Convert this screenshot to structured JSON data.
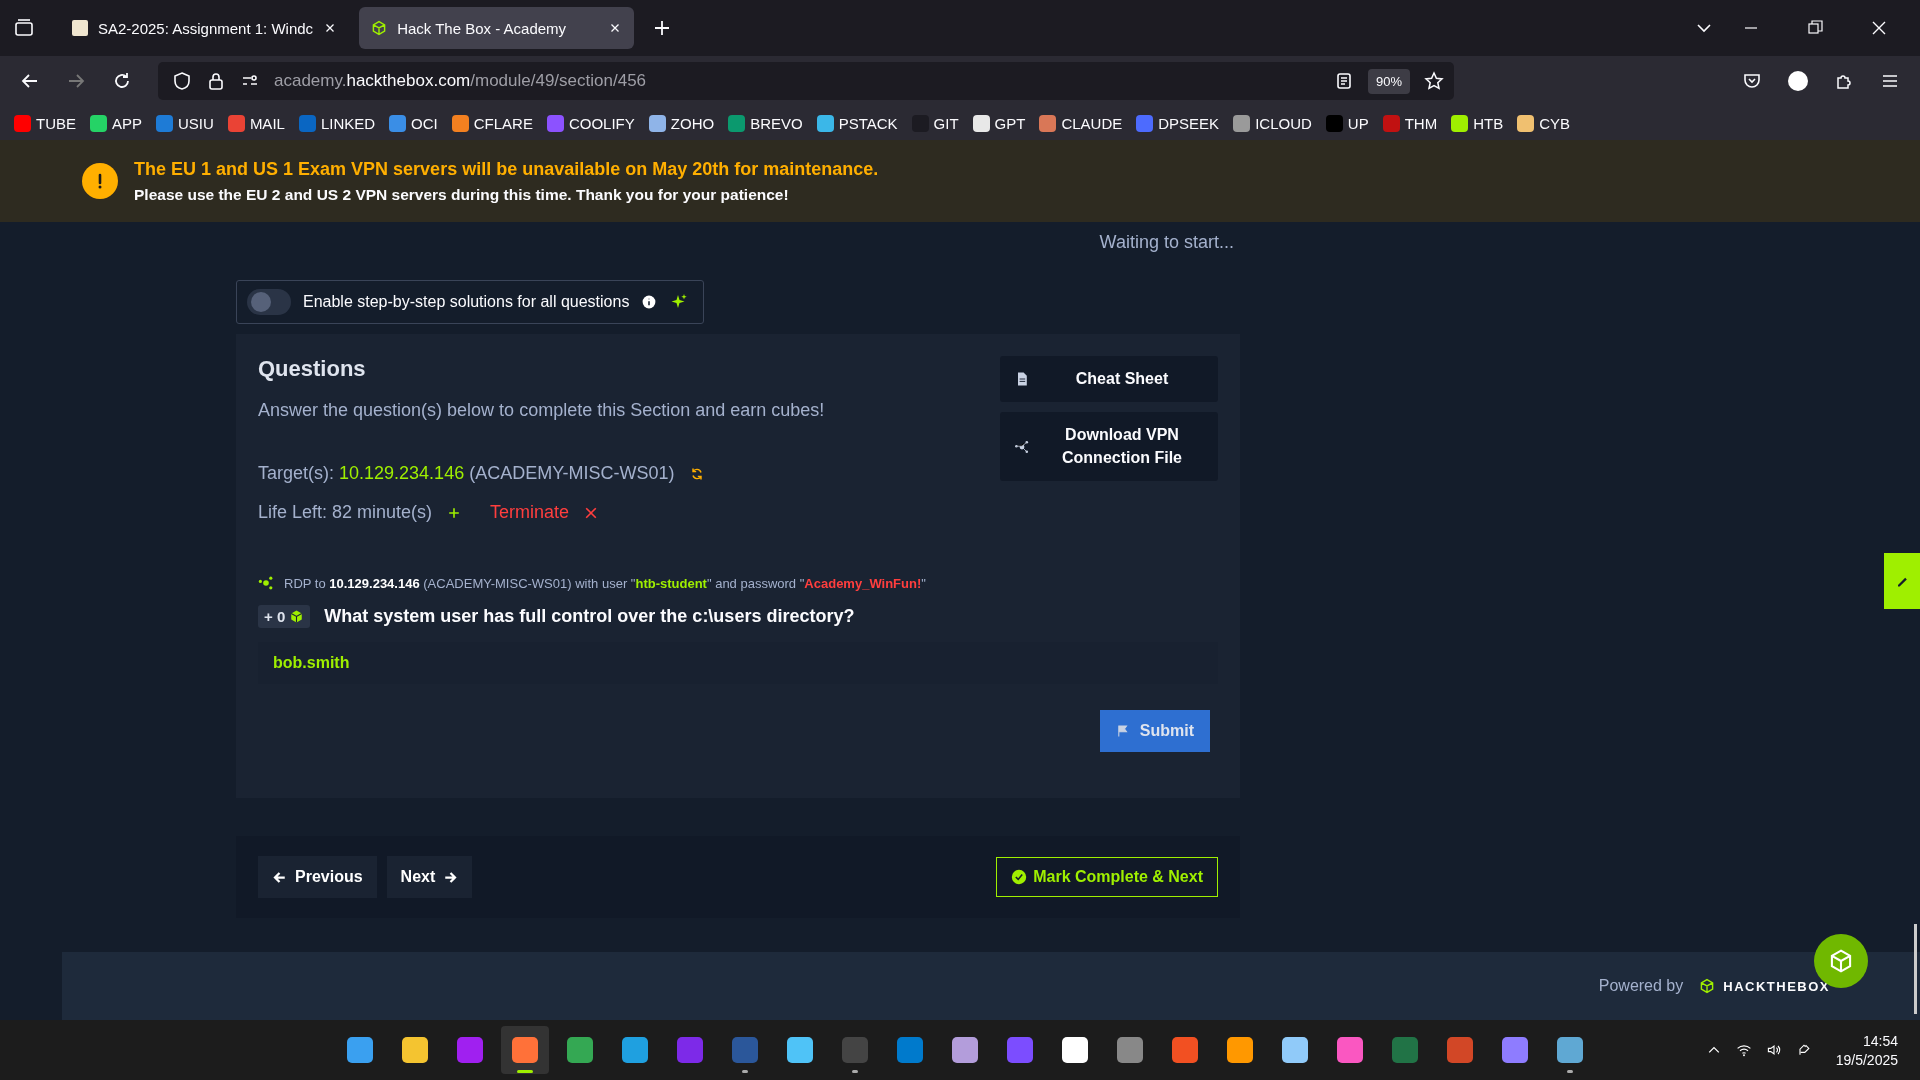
{
  "browser": {
    "tabs": [
      {
        "title": "SA2-2025: Assignment 1: Windc",
        "selected": false
      },
      {
        "title": "Hack The Box - Academy",
        "selected": true
      }
    ],
    "url": {
      "pre": "academy.",
      "domain": "hackthebox.com",
      "path": "/module/49/section/456"
    },
    "zoom": "90%",
    "bookmarks": [
      {
        "label": "TUBE",
        "color": "#ff0000"
      },
      {
        "label": "APP",
        "color": "#25d366"
      },
      {
        "label": "USIU",
        "color": "#1e7bd6"
      },
      {
        "label": "MAIL",
        "color": "#ea4335"
      },
      {
        "label": "LINKED",
        "color": "#0a66c2"
      },
      {
        "label": "OCI",
        "color": "#3a8ee6"
      },
      {
        "label": "CFLARE",
        "color": "#f38020"
      },
      {
        "label": "COOLIFY",
        "color": "#8c52ff"
      },
      {
        "label": "ZOHO",
        "color": "#8fb4e8"
      },
      {
        "label": "BREVO",
        "color": "#0b996e"
      },
      {
        "label": "PSTACK",
        "color": "#3bb7e8"
      },
      {
        "label": "GIT",
        "color": "#1c1b22"
      },
      {
        "label": "GPT",
        "color": "#e8e8e8"
      },
      {
        "label": "CLAUDE",
        "color": "#d97757"
      },
      {
        "label": "DPSEEK",
        "color": "#4d6bfe"
      },
      {
        "label": "ICLOUD",
        "color": "#9a9a9a"
      },
      {
        "label": "UP",
        "color": "#000000"
      },
      {
        "label": "THM",
        "color": "#c11111"
      },
      {
        "label": "HTB",
        "color": "#9fef00"
      },
      {
        "label": "CYB",
        "color": "#f0c070"
      }
    ]
  },
  "banner": {
    "title": "The EU 1 and US 1 Exam VPN servers will be unavailable on May 20th for maintenance.",
    "message": "Please use the EU 2 and US 2 VPN servers during this time. Thank you for your patience!"
  },
  "status": "Waiting to start...",
  "solutions_toggle": {
    "label": "Enable step-by-step solutions for all questions",
    "on": false
  },
  "questions": {
    "title": "Questions",
    "subtitle": "Answer the question(s) below to complete this Section and earn cubes!",
    "target": {
      "label": "Target(s):",
      "ip": "10.129.234.146",
      "host": "(ACADEMY-MISC-WS01)"
    },
    "life": "Life Left: 82 minute(s)",
    "terminate": "Terminate",
    "side_buttons": [
      {
        "label": "Cheat Sheet",
        "kind": "sheet"
      },
      {
        "label": "Download VPN Connection File",
        "kind": "vpn"
      }
    ],
    "rdp": [
      {
        "text": "RDP to ",
        "kind": "plain"
      },
      {
        "text": "10.129.234.146",
        "kind": "bold"
      },
      {
        "text": " (ACADEMY-MISC-WS01) with user \"",
        "kind": "plain"
      },
      {
        "text": "htb-student",
        "kind": "user"
      },
      {
        "text": "\" and password \"",
        "kind": "plain"
      },
      {
        "text": "Academy_WinFun!",
        "kind": "password"
      },
      {
        "text": "\"",
        "kind": "plain"
      }
    ],
    "reward": "+ 0",
    "question": "What system user has full control over the c:\\users directory?",
    "answer": "bob.smith",
    "submit": "Submit"
  },
  "nav": {
    "previous": "Previous",
    "next": "Next",
    "complete": "Mark Complete & Next"
  },
  "footer": {
    "powered": "Powered by",
    "brand": "HACKTHEBOX"
  },
  "taskbar": {
    "apps": [
      {
        "color": "#3aa0f0",
        "open": false,
        "selected": false
      },
      {
        "color": "#f4c430",
        "open": false,
        "selected": false
      },
      {
        "color": "#a020f0",
        "open": false,
        "selected": false
      },
      {
        "color": "#ff7139",
        "open": true,
        "selected": true
      },
      {
        "color": "#34a853",
        "open": false,
        "selected": false
      },
      {
        "color": "#1fa0e0",
        "open": false,
        "selected": false
      },
      {
        "color": "#7d2ae8",
        "open": false,
        "selected": false
      },
      {
        "color": "#2b579a",
        "open": true,
        "selected": false
      },
      {
        "color": "#4fc3f7",
        "open": false,
        "selected": false
      },
      {
        "color": "#444444",
        "open": true,
        "selected": false
      },
      {
        "color": "#007acc",
        "open": false,
        "selected": false
      },
      {
        "color": "#b39ddb",
        "open": false,
        "selected": false
      },
      {
        "color": "#7c4dff",
        "open": false,
        "selected": false
      },
      {
        "color": "#ffffff",
        "open": false,
        "selected": false
      },
      {
        "color": "#888888",
        "open": false,
        "selected": false
      },
      {
        "color": "#f25022",
        "open": false,
        "selected": false
      },
      {
        "color": "#ff9800",
        "open": false,
        "selected": false
      },
      {
        "color": "#90caf9",
        "open": false,
        "selected": false
      },
      {
        "color": "#fa57c1",
        "open": false,
        "selected": false
      },
      {
        "color": "#217346",
        "open": false,
        "selected": false
      },
      {
        "color": "#d24726",
        "open": false,
        "selected": false
      },
      {
        "color": "#8e7cff",
        "open": false,
        "selected": false
      },
      {
        "color": "#5fa8d3",
        "open": true,
        "selected": false
      }
    ],
    "time": "14:54",
    "date": "19/5/2025"
  }
}
